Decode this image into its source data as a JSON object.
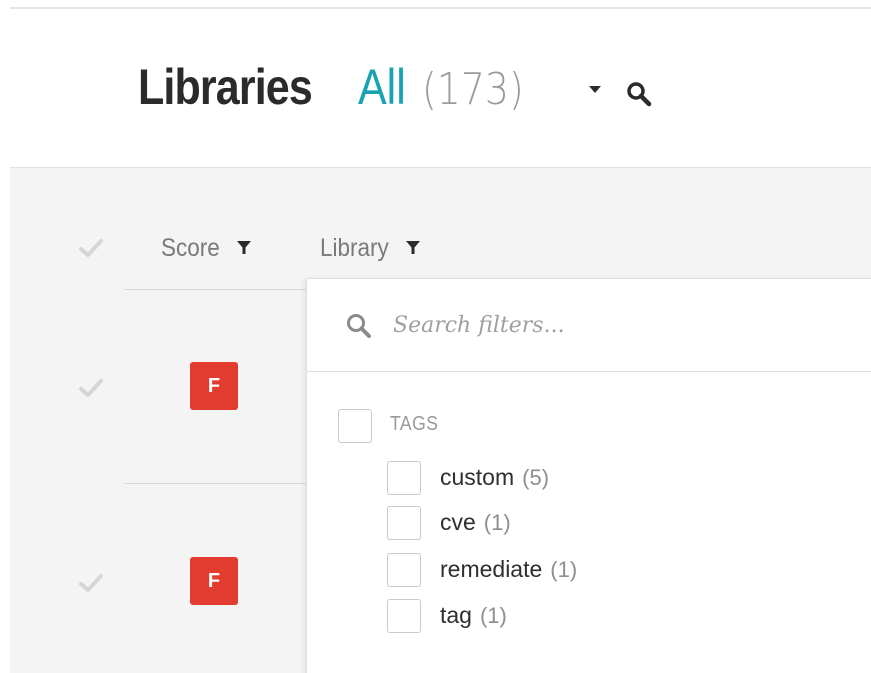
{
  "header": {
    "title": "Libraries",
    "filter": "All",
    "count": "(173)",
    "icons": {
      "caret": "caret-down-icon",
      "search": "search-icon"
    },
    "accent_color": "#19a3b1"
  },
  "table": {
    "columns": [
      {
        "label": "Score",
        "icon": "filter-funnel-icon"
      },
      {
        "label": "Library",
        "icon": "filter-funnel-icon"
      }
    ],
    "rows": [
      {
        "grade": "F",
        "grade_color": "#e23b2f"
      },
      {
        "grade": "F",
        "grade_color": "#e23b2f"
      }
    ]
  },
  "filter_panel": {
    "search": {
      "placeholder": "Search filters...",
      "value": ""
    },
    "group": {
      "label": "TAGS",
      "options": [
        {
          "label": "custom",
          "count": "(5)"
        },
        {
          "label": "cve",
          "count": "(1)"
        },
        {
          "label": "remediate",
          "count": "(1)"
        },
        {
          "label": "tag",
          "count": "(1)"
        }
      ]
    }
  }
}
